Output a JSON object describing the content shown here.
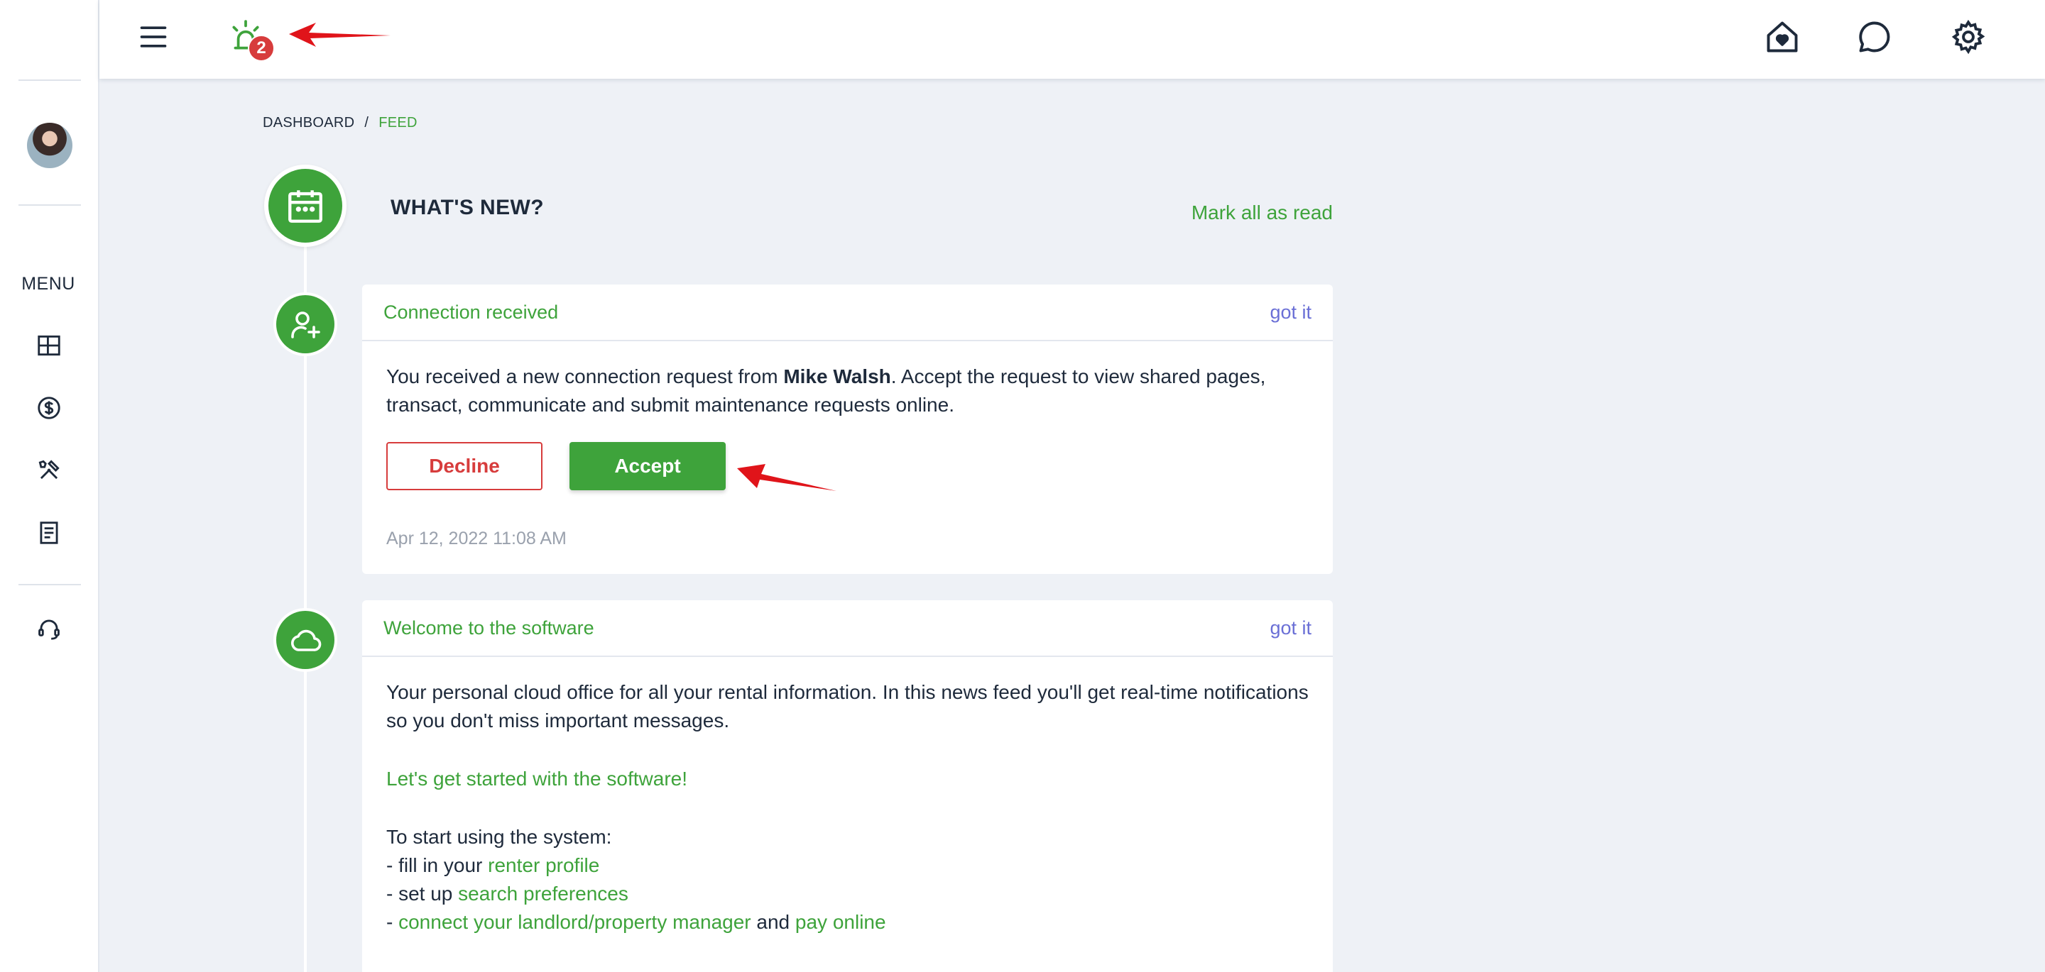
{
  "topbar": {
    "notification_count": "2",
    "icons": [
      "menu-icon",
      "alarm-bell-icon",
      "home-heart-icon",
      "chat-icon",
      "gear-icon"
    ]
  },
  "sidebar": {
    "menu_label": "MENU",
    "items": [
      "dashboard-icon",
      "dollar-icon",
      "tools-icon",
      "document-icon",
      "support-headset-icon"
    ]
  },
  "breadcrumb": {
    "root": "DASHBOARD",
    "separator": "/",
    "current": "FEED"
  },
  "feed": {
    "title": "WHAT'S NEW?",
    "mark_all": "Mark all as read"
  },
  "card1": {
    "title": "Connection received",
    "got_it": "got it",
    "text_before": "You received a new connection request from ",
    "name": "Mike Walsh",
    "text_after": ". Accept the request to view shared pages, transact, communicate and submit maintenance requests online.",
    "decline": "Decline",
    "accept": "Accept",
    "timestamp": "Apr 12, 2022 11:08 AM"
  },
  "card2": {
    "title": "Welcome to the software",
    "got_it": "got it",
    "intro": "Your personal cloud office for all your rental information. In this news feed you'll get real-time notifications so you don't miss important messages.",
    "get_started": "Let's get started with the software!",
    "start_heading": "To start using the system:",
    "item1_prefix": "- fill in your ",
    "item1_link": "renter profile",
    "item2_prefix": "- set up ",
    "item2_link": "search preferences",
    "item3_prefix": "- ",
    "item3_link": "connect your landlord/property manager",
    "item3_and": " and ",
    "item3_link2": "pay online"
  },
  "colors": {
    "accent_green": "#3ea33b",
    "danger_red": "#d73c3c",
    "link_purple": "#6a6fd6",
    "annotation_red": "#e0141a"
  }
}
